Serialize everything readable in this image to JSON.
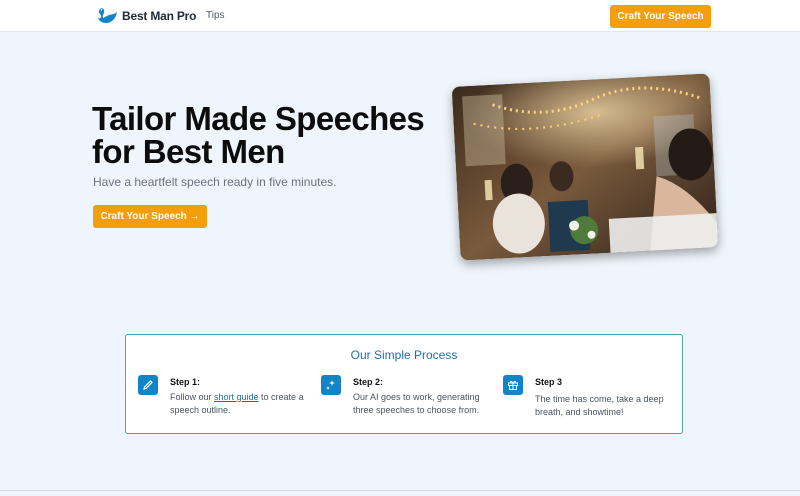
{
  "nav": {
    "brand": "Best Man Pro",
    "link_tips": "Tips",
    "cta": "Craft Your Speech"
  },
  "hero": {
    "title": "Tailor Made Speeches for Best Men",
    "subtitle": "Have a heartfelt speech ready in five minutes.",
    "cta": "Craft Your Speech →",
    "image_icon": "wedding-toast-photo"
  },
  "process": {
    "title": "Our Simple Process",
    "steps": [
      {
        "title": "Step 1:",
        "body_before": "Follow our ",
        "link": "short guide",
        "body_after": " to create a speech outline.",
        "icon": "pencil-icon"
      },
      {
        "title": "Step 2:",
        "body": "Our AI goes to work, generating three speeches to choose from.",
        "icon": "sparkles-icon"
      },
      {
        "title": "Step 3",
        "body": "The time has come, take a deep breath, and showtime!",
        "icon": "gift-icon"
      }
    ]
  },
  "colors": {
    "accent": "#f59e0b",
    "primary": "#1384c7",
    "background": "#eef5fc"
  }
}
